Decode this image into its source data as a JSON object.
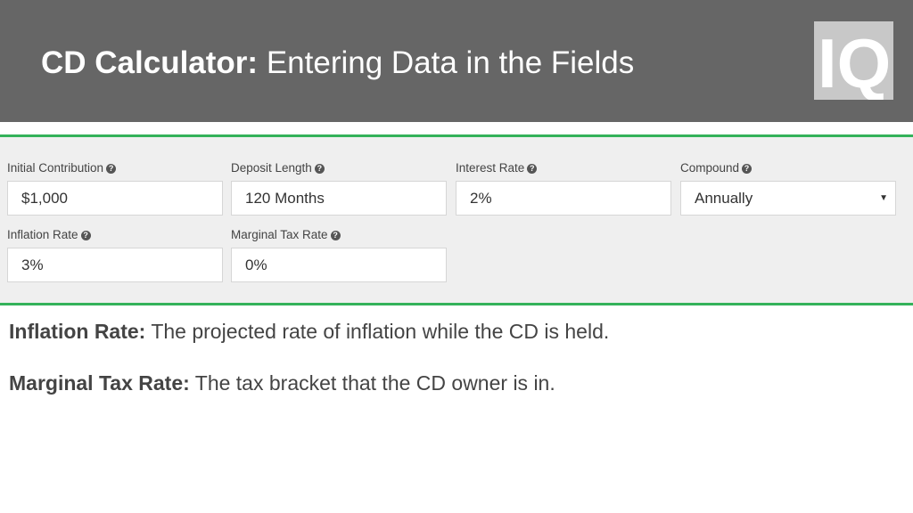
{
  "header": {
    "title_bold": "CD Calculator:",
    "title_rest": " Entering Data in the Fields",
    "logo_text": "IQ"
  },
  "form": {
    "help_glyph": "?",
    "fields": [
      {
        "label": "Initial Contribution",
        "value": "$1,000"
      },
      {
        "label": "Deposit Length",
        "value": "120 Months"
      },
      {
        "label": "Interest Rate",
        "value": "2%"
      },
      {
        "label": "Compound",
        "value": "Annually",
        "type": "select"
      },
      {
        "label": "Inflation Rate",
        "value": "3%"
      },
      {
        "label": "Marginal Tax Rate",
        "value": "0%"
      }
    ]
  },
  "descriptions": [
    {
      "term": "Inflation Rate:",
      "text": " The projected rate of inflation while the CD is held."
    },
    {
      "term": "Marginal Tax Rate:",
      "text": " The tax bracket that the CD owner is in."
    }
  ],
  "colors": {
    "header_bg": "#666666",
    "accent_green": "#34b25a",
    "logo_bg": "#c8c8c8"
  }
}
